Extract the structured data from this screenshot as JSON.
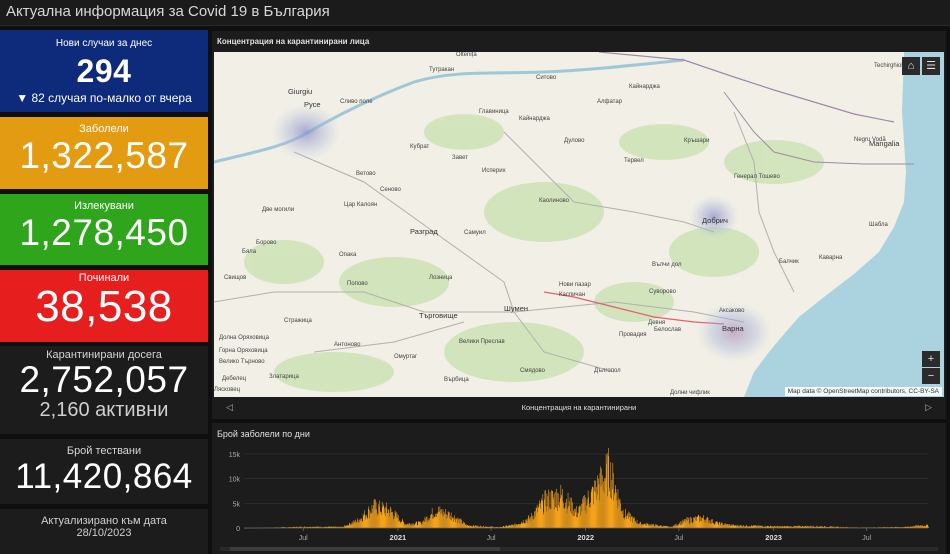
{
  "header": {
    "title": "Актуална информация за Covid 19 в България"
  },
  "cards": {
    "new_cases": {
      "label": "Нови случаи за днес",
      "value": "294",
      "delta": "▼ 82 случая по-малко от вчера",
      "color": "#0e2a7a"
    },
    "sick": {
      "label": "Заболели",
      "value": "1,322,587",
      "color": "#e39b12"
    },
    "recovered": {
      "label": "Излекувани",
      "value": "1,278,450",
      "color": "#2fa51c"
    },
    "deaths": {
      "label": "Починали",
      "value": "38,538",
      "color": "#e61e1e"
    },
    "quarantined": {
      "label": "Карантинирани досега",
      "value": "2,752,057",
      "active": "2,160 активни"
    },
    "tests": {
      "label": "Брой тествани",
      "value": "11,420,864"
    },
    "updated": {
      "label": "Актуализирано към дата",
      "date": "28/10/2023"
    }
  },
  "map": {
    "title": "Концентрация на карантинирани лица",
    "footer_caption": "Концентрация на карантинирани",
    "attribution": "Map data © OpenStreetMap contributors, CC-BY-SA",
    "controls": {
      "home_icon": "home-icon",
      "legend_icon": "legend-list-icon",
      "zoom_in": "+",
      "zoom_out": "−"
    },
    "labels": [
      "Oltenița",
      "Тутракан",
      "Ситово",
      "Кайнарджа",
      "Techirghiol",
      "Giurgiu",
      "Русе",
      "Сливо поле",
      "Главиница",
      "Алфатар",
      "Кубрат",
      "Завет",
      "Дулово",
      "Кръшари",
      "Negru Vodă",
      "Mangalia",
      "Исперих",
      "Тервел",
      "Ветово",
      "Сеново",
      "Генерал Тошево",
      "Цар Калоян",
      "Кайнарджа",
      "Каолиново",
      "Две могили",
      "Добрич",
      "Разград",
      "Самуил",
      "Шабла",
      "Борово",
      "Бяла",
      "Опака",
      "Вълчи дол",
      "Балчик",
      "Каварна",
      "Свищов",
      "Попово",
      "Лозница",
      "Нови пазар",
      "Каспичан",
      "Суворово",
      "Търговище",
      "Шумен",
      "Девня",
      "Аксаково",
      "Белослав",
      "Варна",
      "Стражица",
      "Провадия",
      "Долна Оряховица",
      "Антоново",
      "Велики Преслав",
      "Горна Оряховица",
      "Велико Търново",
      "Омуртаг",
      "Смядово",
      "Дългопол",
      "Дебелец",
      "Златарица",
      "Върбица",
      "Долни чифлик",
      "Лясковец",
      "Елена"
    ],
    "heat_spots": [
      "Русе",
      "Добрич",
      "Варна"
    ]
  },
  "chart": {
    "title": "Брой заболели по дни",
    "x_tick_labels": [
      "Jul",
      "2021",
      "Jul",
      "2022",
      "Jul",
      "2023",
      "Jul"
    ],
    "y_tick_labels": [
      "0",
      "5k",
      "10k",
      "15k"
    ],
    "bar_color": "#f5a21b"
  },
  "chart_data": {
    "type": "bar",
    "title": "Брой заболели по дни",
    "xlabel": "",
    "ylabel": "",
    "ylim": [
      0,
      15000
    ],
    "x_range": [
      "2020-03-08",
      "2023-10-28"
    ],
    "x": [
      "2020-04",
      "2020-07",
      "2020-09",
      "2020-10",
      "2020-11",
      "2020-12",
      "2021-01",
      "2021-02",
      "2021-03",
      "2021-04",
      "2021-05",
      "2021-07",
      "2021-08",
      "2021-09",
      "2021-10",
      "2021-11",
      "2021-12",
      "2022-01",
      "2022-02",
      "2022-03",
      "2022-04",
      "2022-06",
      "2022-07",
      "2022-08",
      "2022-09",
      "2022-10",
      "2023-01",
      "2023-03",
      "2023-06",
      "2023-09",
      "2023-10"
    ],
    "values": [
      50,
      250,
      200,
      1500,
      4200,
      3500,
      800,
      1000,
      3500,
      2500,
      500,
      150,
      600,
      2000,
      5500,
      6500,
      3000,
      7000,
      11500,
      3000,
      900,
      200,
      1500,
      2000,
      900,
      500,
      300,
      350,
      80,
      200,
      500
    ]
  }
}
